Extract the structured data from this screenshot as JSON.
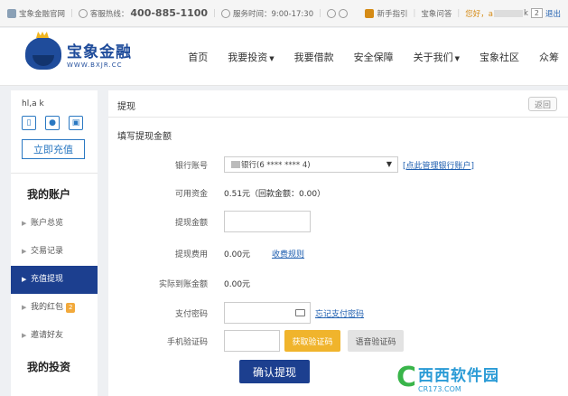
{
  "topbar": {
    "official_site": "宝象金融官网",
    "hotline_label": "客服热线：",
    "hotline_number": "400-885-1100",
    "service_hours": "服务时间：9:00-17:30",
    "new_user_guide": "新手指引",
    "qa": "宝象问答",
    "greeting": "您好，a",
    "greeting_tail": "k",
    "message_count": "2",
    "logout": "退出"
  },
  "header": {
    "logo_cn": "宝象金融",
    "logo_en": "WWW.BXJR.CC",
    "nav": [
      {
        "label": "首页",
        "dropdown": false
      },
      {
        "label": "我要投资",
        "dropdown": true
      },
      {
        "label": "我要借款",
        "dropdown": false
      },
      {
        "label": "安全保障",
        "dropdown": false
      },
      {
        "label": "关于我们",
        "dropdown": true
      },
      {
        "label": "宝象社区",
        "dropdown": false
      },
      {
        "label": "众筹",
        "dropdown": false
      }
    ]
  },
  "sidebar": {
    "username": "hl,a        k",
    "recharge_label": "立即充值",
    "my_account_title": "我的账户",
    "account_items": [
      {
        "label": "账户总览",
        "active": false
      },
      {
        "label": "交易记录",
        "active": false
      },
      {
        "label": "充值提现",
        "active": true
      },
      {
        "label": "我的红包",
        "active": false,
        "badge": "2"
      },
      {
        "label": "邀请好友",
        "active": false
      }
    ],
    "my_investment_title": "我的投资"
  },
  "content": {
    "title": "提现",
    "back_label": "返回",
    "subtitle": "填写提现金额",
    "bank_account_label": "银行账号",
    "bank_account_value": "银行(6  **** **** 4)",
    "manage_bank_link": "[点此管理银行账户]",
    "available_label": "可用资金",
    "available_value": "0.51元（回款金额：0.00）",
    "amount_label": "提现金额",
    "fee_label": "提现费用",
    "fee_value": "0.00元",
    "fee_rule_link": "收费规则",
    "actual_label": "实际到账金额",
    "actual_value": "0.00元",
    "pay_pwd_label": "支付密码",
    "forgot_pwd_link": "忘记支付密码",
    "sms_label": "手机验证码",
    "get_code_label": "获取验证码",
    "voice_code_label": "语音验证码",
    "submit_label": "确认提现"
  },
  "watermark": {
    "main": "西西软件园",
    "sub": "CR173.COM"
  }
}
